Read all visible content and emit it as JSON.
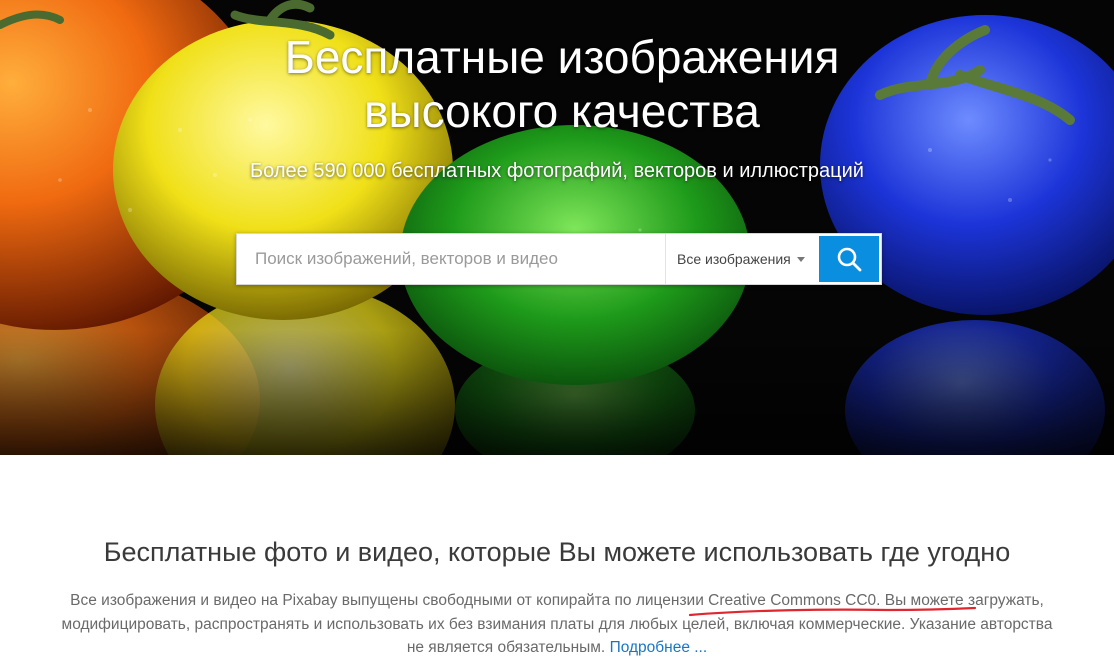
{
  "hero": {
    "title_line1": "Бесплатные изображения",
    "title_line2": "высокого качества",
    "subtitle": "Более 590 000 бесплатных фотографий, векторов и иллюстраций"
  },
  "search": {
    "placeholder": "Поиск изображений, векторов и видео",
    "type_selected": "Все изображения",
    "button_icon": "search-icon"
  },
  "intro": {
    "heading": "Бесплатные фото и видео, которые Вы можете использовать где угодно",
    "text_line1": "Все изображения и видео на Pixabay выпущены свободными от копирайта по лицензии Creative Commons CC0. Вы можете загружать,",
    "text_line2": "модифицировать, распространять и использовать их без взимания платы для любых целей, включая коммерческие. Указание авторства",
    "text_line3": "не является обязательным.",
    "more_link": "Подробнее ..."
  },
  "colors": {
    "accent": "#0a8ee0",
    "link": "#1976c6",
    "annotation": "#e0262e"
  }
}
